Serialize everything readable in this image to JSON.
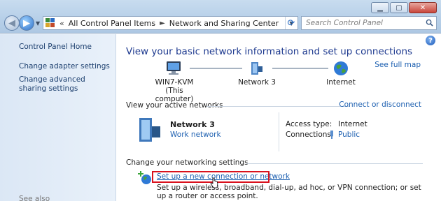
{
  "window": {
    "minimize": "▁",
    "maximize": "▢",
    "close": "✕"
  },
  "address": {
    "prefix": "«",
    "crumbs": [
      "All Control Panel Items",
      "Network and Sharing Center"
    ],
    "separator": "►"
  },
  "search": {
    "placeholder": "Search Control Panel"
  },
  "sidebar": {
    "home": "Control Panel Home",
    "items": [
      {
        "label": "Change adapter settings"
      },
      {
        "label": "Change advanced sharing settings"
      }
    ],
    "see_also": "See also"
  },
  "main": {
    "heading": "View your basic network information and set up connections",
    "full_map": "See full map",
    "map": [
      {
        "label": "WIN7-KVM",
        "sub": "(This computer)"
      },
      {
        "label": "Network  3",
        "sub": ""
      },
      {
        "label": "Internet",
        "sub": ""
      }
    ],
    "active_title": "View your active networks",
    "connect_disconnect": "Connect or disconnect",
    "network": {
      "name": "Network  3",
      "type": "Work network",
      "access_label": "Access type:",
      "access_value": "Internet",
      "connections_label": "Connections:",
      "connections_value": "Public"
    },
    "settings_title": "Change your networking settings",
    "setup_link": "Set up a new connection or network",
    "setup_desc": "Set up a wireless,  broadband, dial-up, ad hoc, or VPN connection; or set up a router or access point."
  },
  "colors": {
    "accent": "#1c5fb0",
    "heading": "#1e3a8f",
    "highlight": "#d9121d"
  }
}
